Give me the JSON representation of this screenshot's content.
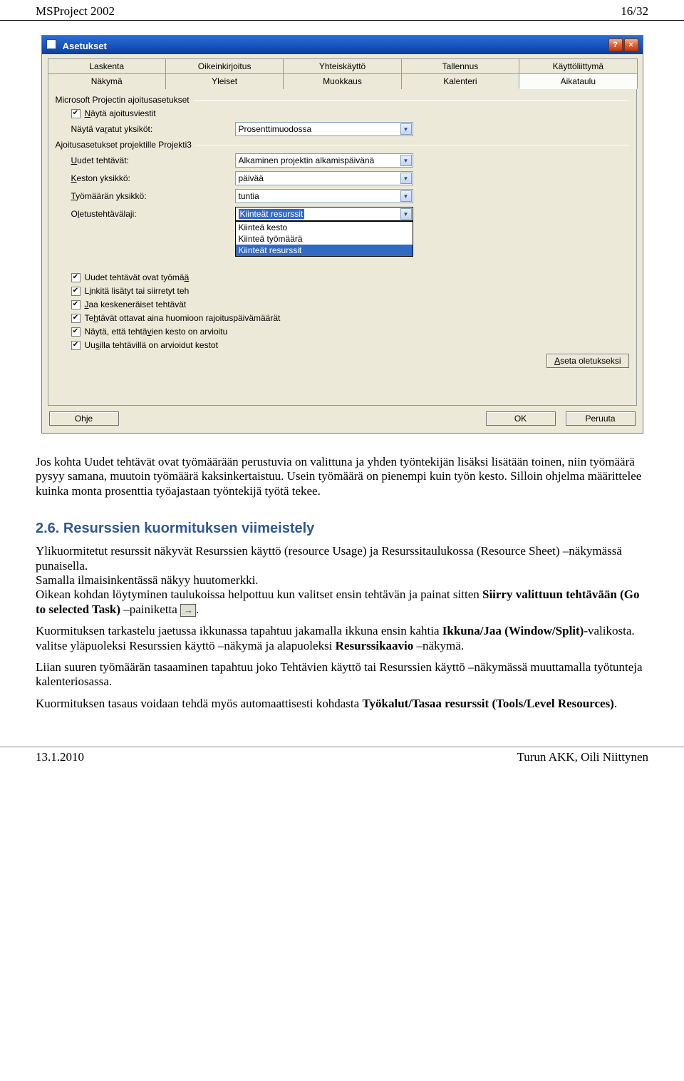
{
  "header": {
    "left": "MSProject 2002",
    "right": "16/32"
  },
  "dlg": {
    "title": "Asetukset",
    "tabs_row1": [
      "Laskenta",
      "Oikeinkirjoitus",
      "Yhteiskäyttö",
      "Tallennus",
      "Käyttöliittymä"
    ],
    "tabs_row2": [
      "Näkymä",
      "Yleiset",
      "Muokkaus",
      "Kalenteri",
      "Aikataulu"
    ],
    "group1": "Microsoft Projectin ajoitusasetukset",
    "chk1": "Näytä ajoitusviestit",
    "lbl_units": "Näytä varatut yksiköt:",
    "dd_units": "Prosenttimuodossa",
    "group2": "Ajoitusasetukset projektille Projekti3",
    "lbl_new": "Uudet tehtävät:",
    "dd_new": "Alkaminen projektin alkamispäivänä",
    "lbl_dur": "Keston yksikkö:",
    "dd_dur": "päivää",
    "lbl_work": "Työmäärän yksikkö:",
    "dd_work": "tuntia",
    "lbl_default": "Oletustehtävälaji:",
    "dd_default": "Kiinteät resurssit",
    "dd_opts": [
      "Kiinteä kesto",
      "Kiinteä työmäärä",
      "Kiinteät resurssit"
    ],
    "chk2": "Uudet tehtävät ovat työmää",
    "chk3": "Linkitä lisätyt tai siirretyt teh",
    "chk4": "Jaa keskeneräiset tehtävät",
    "chk5": "Tehtävät ottavat aina huomioon rajoituspäivämäärät",
    "chk6": "Näytä, että tehtävien kesto on arvioitu",
    "chk7": "Uusilla tehtävillä on arvioidut kestot",
    "btn_default": "Aseta oletukseksi",
    "btn_help": "Ohje",
    "btn_ok": "OK",
    "btn_cancel": "Peruuta"
  },
  "body": {
    "p1": "Jos kohta Uudet tehtävät ovat työmäärään perustuvia on valittuna ja yhden työntekijän lisäksi lisätään toinen, niin työmäärä pysyy samana, muutoin työmäärä kaksinkertaistuu. Usein työmäärä on pienempi kuin työn kesto. Silloin ohjelma määrittelee kuinka monta prosenttia työajastaan työntekijä työtä tekee.",
    "h": "2.6.   Resurssien kuormituksen viimeistely",
    "p2a": "Ylikuormitetut resurssit näkyvät Resurssien käyttö (resource Usage) ja Resurssitaulukossa (Resource Sheet) –näkymässä punaisella.",
    "p2b": "Samalla ilmaisinkentässä näkyy huutomerkki.",
    "p2c": "Oikean kohdan löytyminen taulukoissa helpottuu kun valitset ensin tehtävän ja painat sitten ",
    "p2c_b1": "Siirry valittuun tehtävään (Go to selected Task)",
    "p2c_tail": " –painiketta ",
    "p3a": "Kuormituksen tarkastelu jaetussa ikkunassa tapahtuu jakamalla ikkuna ensin kahtia ",
    "p3_b1": "Ikkuna/Jaa (Window/Split)",
    "p3b": "-valikosta. valitse yläpuoleksi Resurssien käyttö –näkymä ja alapuoleksi ",
    "p3_b2": "Resurssikaavio",
    "p3c": " –näkymä.",
    "p4": "Liian suuren työmäärän tasaaminen tapahtuu joko Tehtävien käyttö tai Resurssien käyttö –näkymässä muuttamalla työtunteja kalenteriosassa.",
    "p5a": "Kuormituksen tasaus voidaan tehdä myös automaattisesti kohdasta ",
    "p5_b": "Työkalut/Tasaa resurssit (Tools/Level Resources)",
    "p5b": "."
  },
  "footer": {
    "left": "13.1.2010",
    "right": "Turun AKK, Oili Niittynen"
  }
}
